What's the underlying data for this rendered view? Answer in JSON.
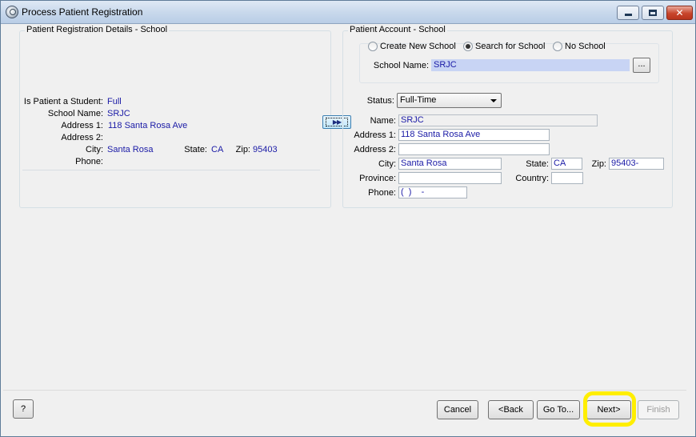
{
  "window": {
    "title": "Process Patient Registration"
  },
  "left": {
    "legend": "Patient Registration Details - School",
    "is_student_label": "Is Patient a Student:",
    "is_student_value": "Full",
    "school_name_label": "School Name:",
    "school_name_value": "SRJC",
    "address1_label": "Address 1:",
    "address1_value": "118 Santa Rosa Ave",
    "address2_label": "Address 2:",
    "address2_value": "",
    "city_label": "City:",
    "city_value": "Santa Rosa",
    "state_label": "State:",
    "state_value": "CA",
    "zip_label": "Zip:",
    "zip_value": "95403",
    "phone_label": "Phone:",
    "phone_value": ""
  },
  "copy_button": {
    "label": "▶▶"
  },
  "right": {
    "legend": "Patient Account - School",
    "radios": {
      "create": "Create New School",
      "search": "Search for School",
      "none": "No School",
      "selected": "search"
    },
    "school_name_label": "School Name:",
    "school_name_value": "SRJC",
    "browse_label": "...",
    "status_label": "Status:",
    "status_value": "Full-Time",
    "name_label": "Name:",
    "name_value": "SRJC",
    "address1_label": "Address 1:",
    "address1_value": "118 Santa Rosa Ave",
    "address2_label": "Address 2:",
    "address2_value": "",
    "city_label": "City:",
    "city_value": "Santa Rosa",
    "state_label": "State:",
    "state_value": "CA",
    "zip_label": "Zip:",
    "zip_value": "95403-",
    "province_label": "Province:",
    "province_value": "",
    "country_label": "Country:",
    "country_value": "",
    "phone_label": "Phone:",
    "phone_value": "(  )    -"
  },
  "footer": {
    "help": "?",
    "cancel": "Cancel",
    "back": "<Back",
    "goto": "Go To...",
    "next": "Next>",
    "finish": "Finish"
  },
  "colors": {
    "value_text": "#1a1aa6",
    "highlight": "#ffee00",
    "selected_field": "#c8d4f4"
  }
}
